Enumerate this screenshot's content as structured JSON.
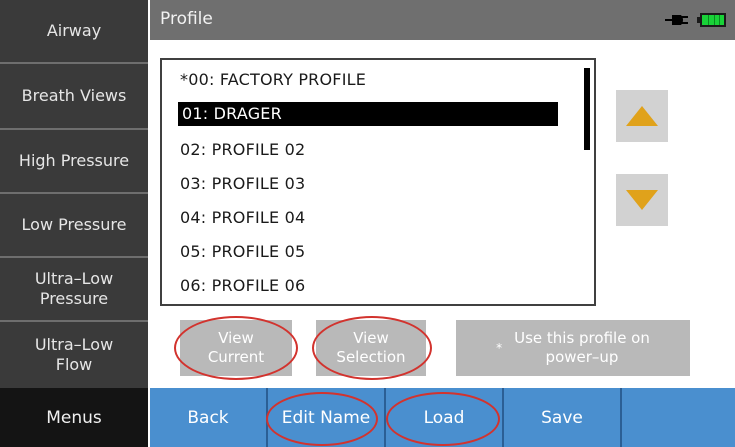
{
  "sidebar": {
    "items": [
      {
        "lines": [
          "Airway"
        ]
      },
      {
        "lines": [
          "Breath Views"
        ]
      },
      {
        "lines": [
          "High Pressure"
        ]
      },
      {
        "lines": [
          "Low Pressure"
        ]
      },
      {
        "lines": [
          "Ultra–Low",
          "Pressure"
        ]
      },
      {
        "lines": [
          "Ultra–Low",
          "Flow"
        ]
      }
    ],
    "menus_label": "Menus"
  },
  "header": {
    "title": "Profile",
    "icons": [
      "plug-icon",
      "battery-icon"
    ]
  },
  "profiles": [
    "*00: FACTORY PROFILE",
    "01: DRAGER",
    "02: PROFILE 02",
    "03: PROFILE 03",
    "04: PROFILE 04",
    "05: PROFILE 05",
    "06: PROFILE 06"
  ],
  "selected_profile": "01: DRAGER",
  "buttons": {
    "view_current": [
      "View",
      "Current"
    ],
    "view_selection": [
      "View",
      "Selection"
    ],
    "use_on_powerup": [
      "Use this profile on",
      "power–up"
    ],
    "use_marker": "*"
  },
  "softkeys": [
    "Back",
    "Edit Name",
    "Load",
    "Save",
    ""
  ],
  "colors": {
    "sidebar": "#3a3a3a",
    "header": "#6f6f6f",
    "softkey_bar": "#4a8fcf",
    "arrow": "#e0a21b",
    "highlight_ring": "#d2332e"
  }
}
